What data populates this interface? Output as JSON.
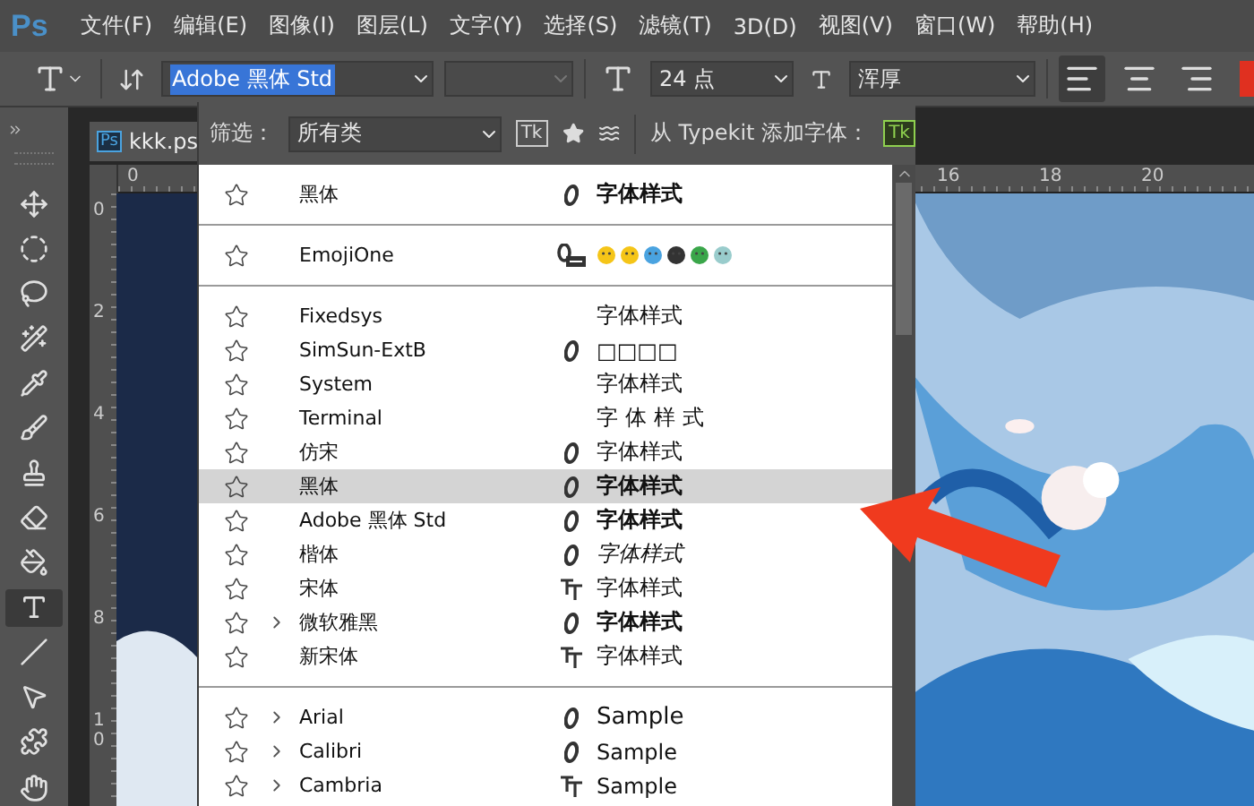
{
  "app_logo": "Ps",
  "menu": [
    "文件(F)",
    "编辑(E)",
    "图像(I)",
    "图层(L)",
    "文字(Y)",
    "选择(S)",
    "滤镜(T)",
    "3D(D)",
    "视图(V)",
    "窗口(W)",
    "帮助(H)"
  ],
  "options_bar": {
    "font_family": "Adobe 黑体 Std",
    "font_size": "24 点",
    "antialias": "浑厚",
    "alignments": [
      {
        "kind": "left",
        "selected": true
      },
      {
        "kind": "center",
        "selected": false
      },
      {
        "kind": "right",
        "selected": false
      }
    ]
  },
  "tools": [
    {
      "kind": "move",
      "selected": false
    },
    {
      "kind": "marquee",
      "selected": false
    },
    {
      "kind": "lasso",
      "selected": false
    },
    {
      "kind": "wand",
      "selected": false
    },
    {
      "kind": "eyedropper",
      "selected": false
    },
    {
      "kind": "brush",
      "selected": false
    },
    {
      "kind": "stamp",
      "selected": false
    },
    {
      "kind": "eraser",
      "selected": false
    },
    {
      "kind": "bucket",
      "selected": false
    },
    {
      "kind": "type",
      "selected": true
    },
    {
      "kind": "path",
      "selected": false
    },
    {
      "kind": "pointer",
      "selected": false
    },
    {
      "kind": "shape",
      "selected": false
    },
    {
      "kind": "hand",
      "selected": false
    }
  ],
  "document_tab": {
    "icon": "Ps",
    "title": "kkk.ps"
  },
  "rulers": {
    "horizontal": [
      "0",
      "16",
      "18",
      "20"
    ],
    "vertical": [
      "0",
      "2",
      "4",
      "6",
      "8",
      "10"
    ]
  },
  "font_menu": {
    "filter_label": "筛选：",
    "filter_value": "所有类",
    "typekit_filter": "Tk",
    "typekit_add_label": "从 Typekit 添加字体：",
    "typekit_icon": "Tk",
    "groups": [
      {
        "rows": [
          {
            "name": "黑体",
            "format": {
              "kind": "opentype"
            },
            "sample": {
              "kind": "bold",
              "text": "字体样式"
            },
            "expandable": false,
            "selected": false
          }
        ]
      },
      {
        "rows": [
          {
            "name": "EmojiOne",
            "format": {
              "kind": "svg"
            },
            "sample": {
              "kind": "emoji"
            },
            "expandable": false,
            "selected": false
          }
        ]
      },
      {
        "rows": [
          {
            "name": "Fixedsys",
            "sample": {
              "kind": "regular",
              "text": "字体样式"
            },
            "expandable": false,
            "selected": false
          },
          {
            "name": "SimSun-ExtB",
            "format": {
              "kind": "opentype"
            },
            "sample": {
              "kind": "regular",
              "text": "□□□□"
            },
            "expandable": false,
            "selected": false
          },
          {
            "name": "System",
            "sample": {
              "kind": "regular",
              "text": "字体样式"
            },
            "expandable": false,
            "selected": false
          },
          {
            "name": "Terminal",
            "sample": {
              "kind": "spaced",
              "text": "字体样式"
            },
            "expandable": false,
            "selected": false
          },
          {
            "name": "仿宋",
            "format": {
              "kind": "opentype"
            },
            "sample": {
              "kind": "regular",
              "text": "字体样式"
            },
            "expandable": false,
            "selected": false
          },
          {
            "name": "黑体",
            "format": {
              "kind": "opentype"
            },
            "sample": {
              "kind": "bold",
              "text": "字体样式"
            },
            "expandable": false,
            "selected": true
          },
          {
            "name": "Adobe 黑体 Std",
            "format": {
              "kind": "opentype"
            },
            "sample": {
              "kind": "bold",
              "text": "字体样式"
            },
            "expandable": false,
            "selected": false
          },
          {
            "name": "楷体",
            "format": {
              "kind": "opentype"
            },
            "sample": {
              "kind": "italic",
              "text": "字体样式"
            },
            "expandable": false,
            "selected": false
          },
          {
            "name": "宋体",
            "format": {
              "kind": "truetype"
            },
            "sample": {
              "kind": "regular",
              "text": "字体样式"
            },
            "expandable": false,
            "selected": false
          },
          {
            "name": "微软雅黑",
            "format": {
              "kind": "opentype"
            },
            "sample": {
              "kind": "bold",
              "text": "字体样式"
            },
            "expandable": true,
            "selected": false
          },
          {
            "name": "新宋体",
            "format": {
              "kind": "truetype"
            },
            "sample": {
              "kind": "regular",
              "text": "字体样式"
            },
            "expandable": false,
            "selected": false
          }
        ]
      },
      {
        "rows": [
          {
            "name": "Arial",
            "format": {
              "kind": "opentype"
            },
            "sample": {
              "kind": "large",
              "text": "Sample"
            },
            "expandable": true,
            "selected": false
          },
          {
            "name": "Calibri",
            "format": {
              "kind": "opentype"
            },
            "sample": {
              "kind": "regular",
              "text": "Sample"
            },
            "expandable": true,
            "selected": false
          },
          {
            "name": "Cambria",
            "format": {
              "kind": "truetype"
            },
            "sample": {
              "kind": "regular",
              "text": "Sample"
            },
            "expandable": true,
            "selected": false
          }
        ]
      }
    ]
  }
}
